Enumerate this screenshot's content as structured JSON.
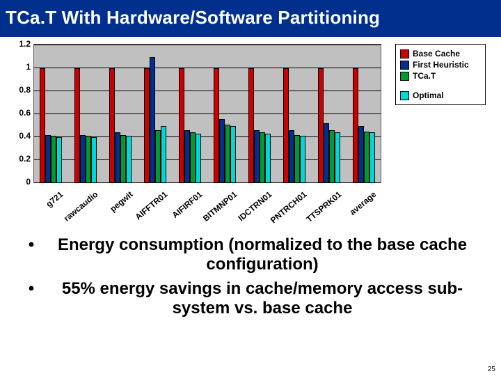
{
  "title": "TCa.T With Hardware/Software Partitioning",
  "page_number": "25",
  "chart_data": {
    "type": "bar",
    "ylabel": "",
    "xlabel": "",
    "ylim": [
      0,
      1.2
    ],
    "yticks": [
      0,
      0.2,
      0.4,
      0.6,
      0.8,
      1,
      1.2
    ],
    "categories": [
      "g721",
      "rawcaudio",
      "pegwit",
      "AIFFTR01",
      "AIFIRF01",
      "BITMNP01",
      "IDCTRN01",
      "PNTRCH01",
      "TTSPRK01",
      "average"
    ],
    "series": [
      {
        "name": "Base Cache",
        "color": "#cc0000",
        "values": [
          1.0,
          1.0,
          1.0,
          1.0,
          1.0,
          1.0,
          1.0,
          1.0,
          1.0,
          1.0
        ]
      },
      {
        "name": "First Heuristic",
        "color": "#002f8e",
        "values": [
          0.42,
          0.42,
          0.44,
          1.1,
          0.46,
          0.56,
          0.46,
          0.46,
          0.52,
          0.5
        ]
      },
      {
        "name": "TCa.T",
        "color": "#009933",
        "values": [
          0.41,
          0.41,
          0.42,
          0.46,
          0.44,
          0.51,
          0.44,
          0.42,
          0.46,
          0.45
        ]
      },
      {
        "name": "Optimal",
        "color": "#00d8d8",
        "values": [
          0.4,
          0.4,
          0.41,
          0.5,
          0.43,
          0.5,
          0.43,
          0.41,
          0.44,
          0.44
        ]
      }
    ]
  },
  "bullets": [
    "Energy consumption (normalized to the base cache configuration)",
    "55% energy savings in cache/memory access sub-system vs. base cache"
  ]
}
